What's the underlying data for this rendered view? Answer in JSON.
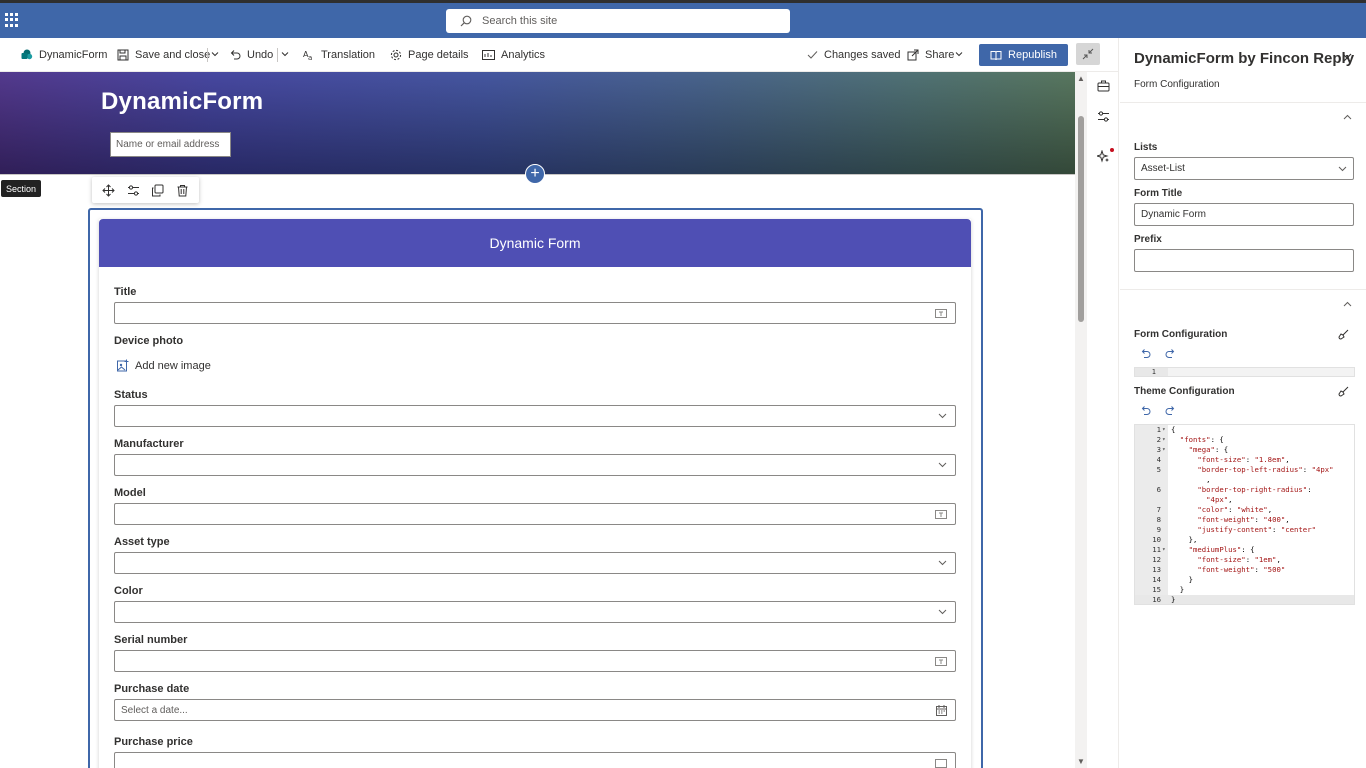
{
  "suite": {
    "search_placeholder": "Search this site"
  },
  "commandbar": {
    "site_name": "DynamicForm",
    "save_close": "Save and close",
    "undo": "Undo",
    "translation": "Translation",
    "page_details": "Page details",
    "analytics": "Analytics",
    "status": "Changes saved",
    "share": "Share",
    "republish": "Republish"
  },
  "hero": {
    "title": "DynamicForm",
    "people_placeholder": "Name or email address"
  },
  "section": {
    "tooltip": "Section"
  },
  "form": {
    "header": "Dynamic Form",
    "add_image": "Add new image",
    "date_placeholder": "Select a date...",
    "fields": {
      "title": "Title",
      "device_photo": "Device photo",
      "status": "Status",
      "manufacturer": "Manufacturer",
      "model": "Model",
      "asset_type": "Asset type",
      "color": "Color",
      "serial_number": "Serial number",
      "purchase_date": "Purchase date",
      "purchase_price": "Purchase price"
    }
  },
  "pane": {
    "title": "DynamicForm by Fincon Reply",
    "subtitle": "Form Configuration",
    "lists_label": "Lists",
    "lists_value": "Asset-List",
    "form_title_label": "Form Title",
    "form_title_value": "Dynamic Form",
    "prefix_label": "Prefix",
    "prefix_value": "",
    "form_config_label": "Form Configuration",
    "theme_config_label": "Theme Configuration",
    "form_config_line": "1",
    "theme_code": [
      {
        "n": "1",
        "f": "▾",
        "t": "{"
      },
      {
        "n": "2",
        "f": "▾",
        "t": "  \"fonts\": {"
      },
      {
        "n": "3",
        "f": "▾",
        "t": "    \"mega\": {"
      },
      {
        "n": "4",
        "f": "",
        "t": "      \"font-size\": \"1.8em\","
      },
      {
        "n": "5",
        "f": "",
        "t": "      \"border-top-left-radius\": \"4px\""
      },
      {
        "n": "",
        "f": "",
        "t": "        ,"
      },
      {
        "n": "6",
        "f": "",
        "t": "      \"border-top-right-radius\":"
      },
      {
        "n": "",
        "f": "",
        "t": "        \"4px\","
      },
      {
        "n": "7",
        "f": "",
        "t": "      \"color\": \"white\","
      },
      {
        "n": "8",
        "f": "",
        "t": "      \"font-weight\": \"400\","
      },
      {
        "n": "9",
        "f": "",
        "t": "      \"justify-content\": \"center\""
      },
      {
        "n": "10",
        "f": "",
        "t": "    },"
      },
      {
        "n": "11",
        "f": "▾",
        "t": "    \"mediumPlus\": {"
      },
      {
        "n": "12",
        "f": "",
        "t": "      \"font-size\": \"1em\","
      },
      {
        "n": "13",
        "f": "",
        "t": "      \"font-weight\": \"500\""
      },
      {
        "n": "14",
        "f": "",
        "t": "    }"
      },
      {
        "n": "15",
        "f": "",
        "t": "  }"
      },
      {
        "n": "16",
        "f": "",
        "t": "}"
      }
    ]
  }
}
